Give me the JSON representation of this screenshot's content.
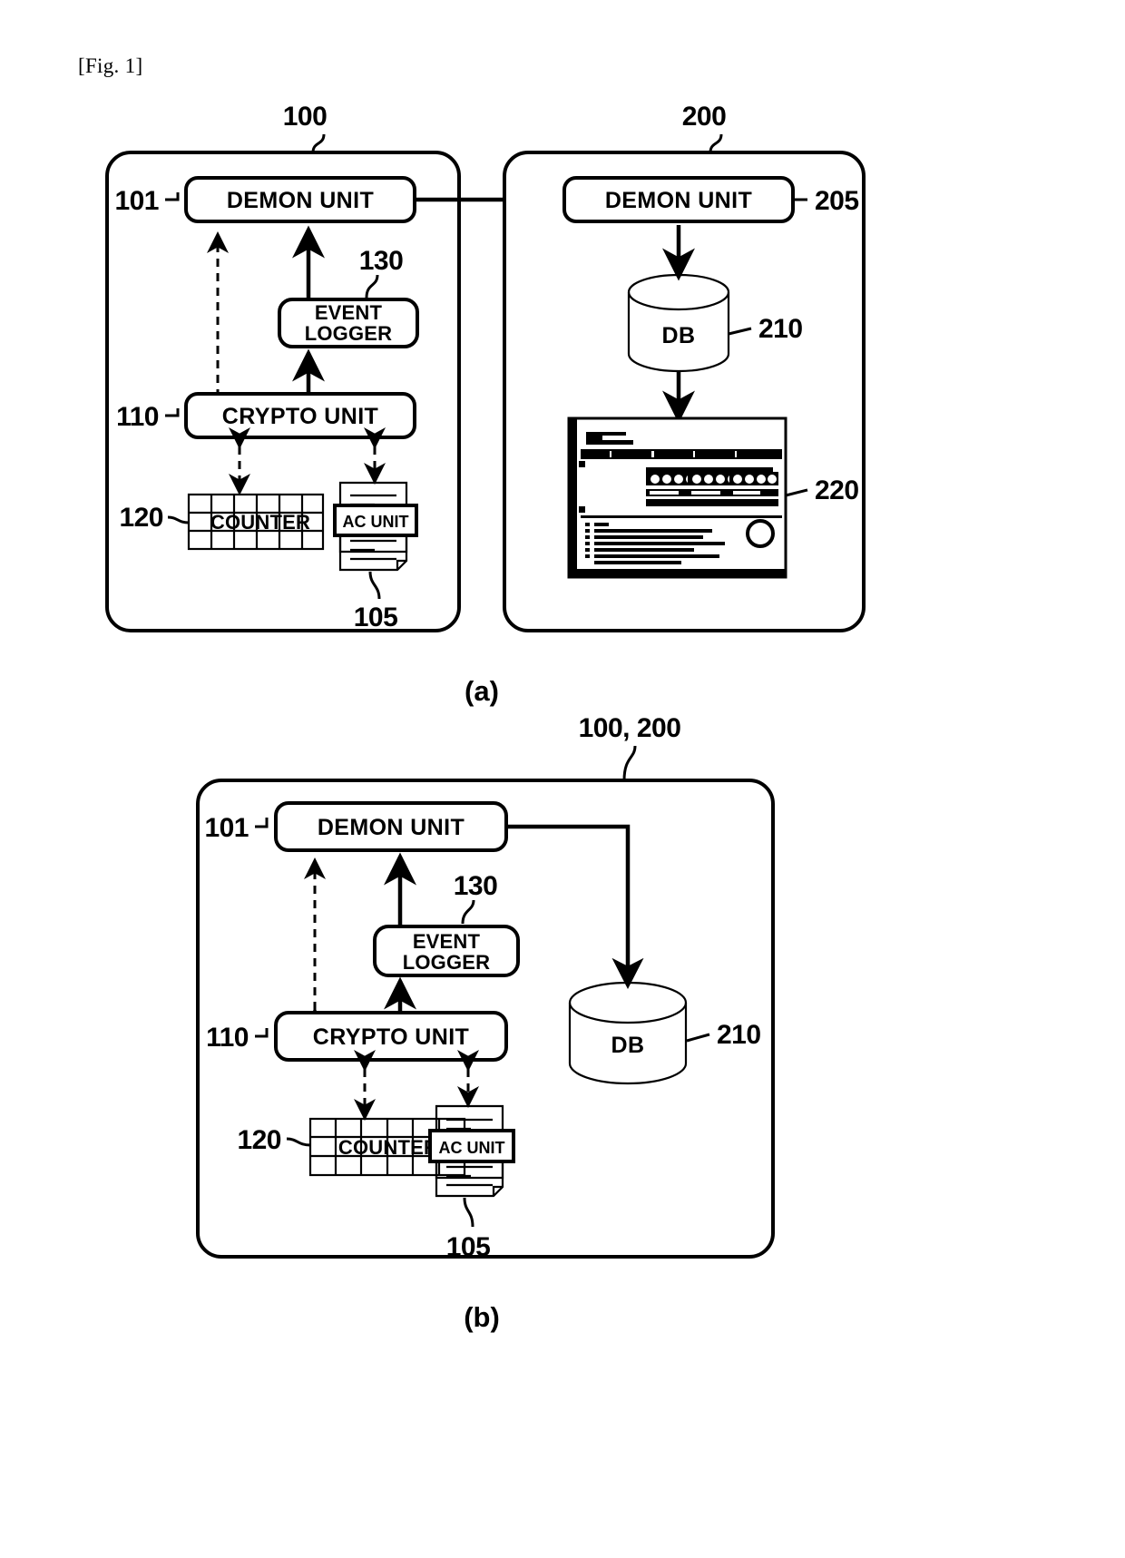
{
  "figure": {
    "label": "[Fig. 1]",
    "captions": {
      "a": "(a)",
      "b": "(b)"
    }
  },
  "panel_a": {
    "client": {
      "ref": "100",
      "blocks": {
        "demon_unit": {
          "label": "DEMON UNIT",
          "ref": "101"
        },
        "event_logger": {
          "label": "EVENT LOGGER",
          "ref": "130"
        },
        "crypto_unit": {
          "label": "CRYPTO UNIT",
          "ref": "110"
        },
        "counter": {
          "label": "COUNTER",
          "ref": "120"
        },
        "ac_unit": {
          "label": "AC UNIT",
          "ref": "105"
        }
      }
    },
    "server": {
      "ref": "200",
      "blocks": {
        "demon_unit": {
          "label": "DEMON UNIT",
          "ref": "205"
        },
        "db": {
          "label": "DB",
          "ref": "210"
        },
        "web_page": {
          "label": "",
          "ref": "220"
        }
      }
    }
  },
  "panel_b": {
    "system": {
      "ref": "100, 200",
      "blocks": {
        "demon_unit": {
          "label": "DEMON UNIT",
          "ref": "101"
        },
        "event_logger": {
          "label": "EVENT LOGGER",
          "ref": "130"
        },
        "crypto_unit": {
          "label": "CRYPTO UNIT",
          "ref": "110"
        },
        "counter": {
          "label": "COUNTER",
          "ref": "120"
        },
        "ac_unit": {
          "label": "AC UNIT",
          "ref": "105"
        },
        "db": {
          "label": "DB",
          "ref": "210"
        }
      }
    }
  },
  "colors": {
    "ink": "#000000",
    "paper": "#ffffff"
  }
}
